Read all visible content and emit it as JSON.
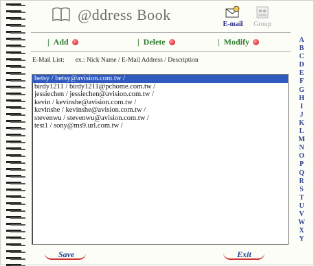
{
  "header": {
    "title": "@ddress Book",
    "tabs": [
      {
        "label": "E-mail",
        "icon": "email-icon",
        "active": true
      },
      {
        "label": "Group",
        "icon": "group-icon",
        "active": false
      }
    ]
  },
  "toolbar": {
    "add_label": "Add",
    "delete_label": "Delete",
    "modify_label": "Modify"
  },
  "list": {
    "label": "E-Mail List:",
    "hint": "ex.: Nick Name / E-Mail Address / Description",
    "selected_index": 0,
    "items": [
      "betsy / betsy@avision.com.tw /",
      "birdy1211 / birdy1211@pchome.com.tw /",
      "jessiechen / jessiechen@avision.com.tw /",
      "kevin / kevinshe@avision.com.tw /",
      "kevinshe / kevinshe@avision.com.tw /",
      "stevenwu / stevenwu@avision.com.tw /",
      "test1 / sony@ms9.url.com.tw /"
    ]
  },
  "footer": {
    "save_label": "Save",
    "exit_label": "Exit"
  },
  "alphabet": [
    "A",
    "B",
    "C",
    "D",
    "E",
    "F",
    "G",
    "H",
    "I",
    "J",
    "K",
    "L",
    "M",
    "N",
    "O",
    "P",
    "Q",
    "R",
    "S",
    "T",
    "U",
    "V",
    "W",
    "X",
    "Y"
  ],
  "colors": {
    "accent_green": "#2f7b2f",
    "selection_blue": "#2f5bc0",
    "letter_blue": "#2e3f8c",
    "dot_red": "#e0303a"
  }
}
